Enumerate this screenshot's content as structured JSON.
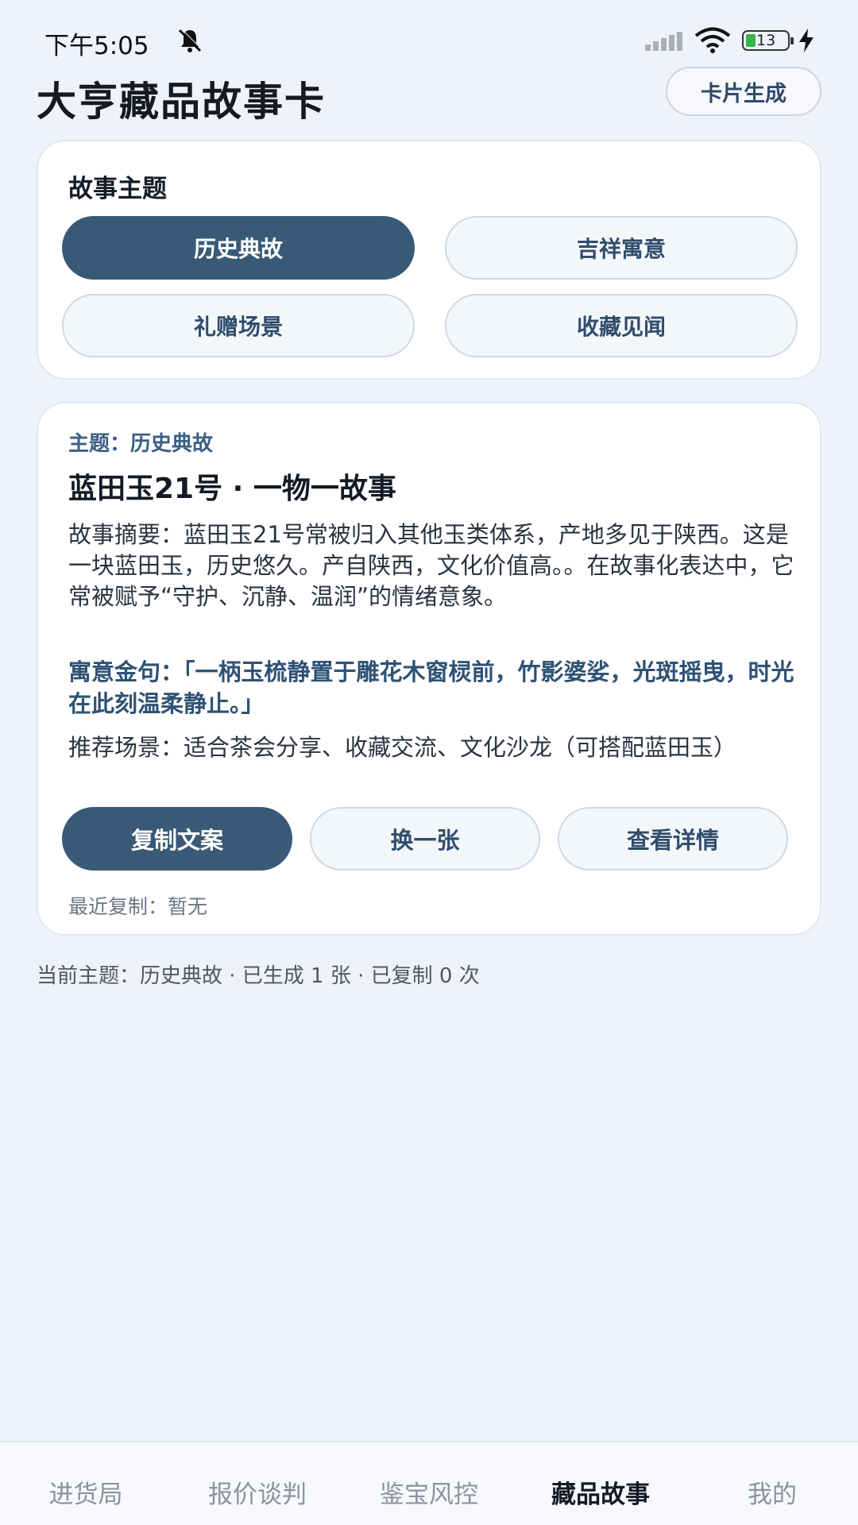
{
  "status_bar": {
    "time": "下午5:05",
    "battery": "13"
  },
  "header": {
    "title": "大亨藏品故事卡",
    "gen_button": "卡片生成"
  },
  "theme_card": {
    "title": "故事主题",
    "chips": [
      {
        "label": "历史典故",
        "active": true
      },
      {
        "label": "吉祥寓意",
        "active": false
      },
      {
        "label": "礼赠场景",
        "active": false
      },
      {
        "label": "收藏见闻",
        "active": false
      }
    ]
  },
  "story": {
    "theme": "主题：历史典故",
    "title": "蓝田玉21号 · 一物一故事",
    "summary": "故事摘要：蓝田玉21号常被归入其他玉类体系，产地多见于陕西。这是一块蓝田玉，历史悠久。产自陕西，文化价值高。。在故事化表达中，它常被赋予“守护、沉静、温润”的情绪意象。",
    "quote": "寓意金句：「一柄玉梳静置于雕花木窗棂前，竹影婆娑，光斑摇曳，时光在此刻温柔静止。」",
    "scene": "推荐场景：适合茶会分享、收藏交流、文化沙龙（可搭配蓝田玉）",
    "buttons": {
      "copy": "复制文案",
      "next": "换一张",
      "detail": "查看详情"
    },
    "last_copy": "最近复制：暂无"
  },
  "summary_line": "当前主题：历史典故 · 已生成 1 张 · 已复制 0 次",
  "bottom_nav": [
    {
      "label": "进货局",
      "active": false
    },
    {
      "label": "报价谈判",
      "active": false
    },
    {
      "label": "鉴宝风控",
      "active": false
    },
    {
      "label": "藏品故事",
      "active": true
    },
    {
      "label": "我的",
      "active": false
    }
  ],
  "colors": {
    "background": "#eef3fb",
    "primary": "#395a77",
    "accent_text": "#2e5275"
  }
}
